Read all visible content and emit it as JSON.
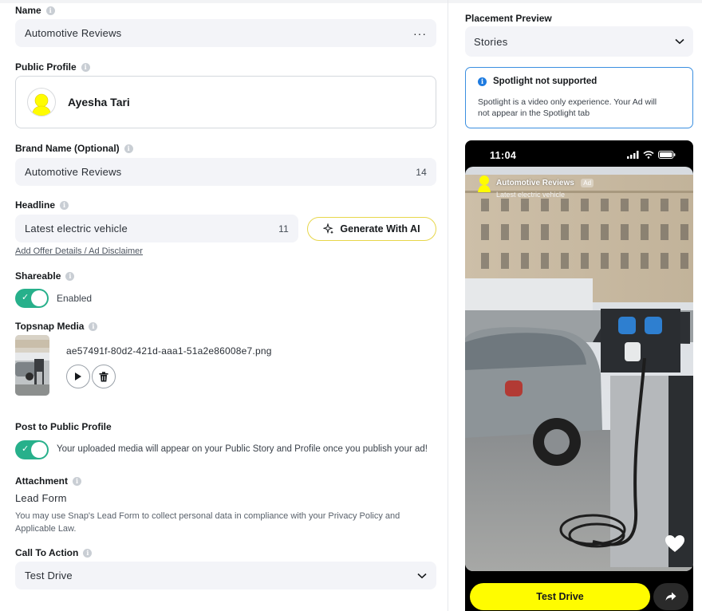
{
  "form": {
    "name": {
      "label": "Name",
      "value": "Automotive Reviews",
      "menu_icon": "more-horizontal-icon"
    },
    "public_profile": {
      "label": "Public Profile",
      "display_name": "Ayesha Tari"
    },
    "brand_name": {
      "label": "Brand Name (Optional)",
      "value": "Automotive Reviews",
      "count": "14"
    },
    "headline": {
      "label": "Headline",
      "value": "Latest electric vehicle",
      "count": "11",
      "generate_label": "Generate With AI",
      "offer_link": "Add Offer Details / Ad Disclaimer"
    },
    "shareable": {
      "label": "Shareable",
      "state": "Enabled",
      "enabled": true
    },
    "topsnap": {
      "label": "Topsnap Media",
      "filename": "ae57491f-80d2-421d-aaa1-51a2e86008e7.png"
    },
    "post_public": {
      "label": "Post to Public Profile",
      "text": "Your uploaded media will appear on your Public Story and Profile once you publish your ad!",
      "enabled": true
    },
    "attachment": {
      "label": "Attachment",
      "value": "Lead Form",
      "note_line1": "You may use Snap's Lead Form to collect personal data in compliance with your Privacy Policy and",
      "note_line2": "Applicable Law."
    },
    "cta": {
      "label": "Call To Action",
      "value": "Test Drive"
    }
  },
  "preview": {
    "label": "Placement Preview",
    "placement": "Stories",
    "notice_title": "Spotlight not supported",
    "notice_line1": "Spotlight is a video only experience. Your Ad will",
    "notice_line2": "not appear in the Spotlight tab",
    "phone_time": "11:04",
    "ad_name": "Automotive Reviews",
    "ad_badge": "Ad",
    "ad_headline": "Latest electric vehicle",
    "cta_label": "Test Drive"
  },
  "colors": {
    "toggle_on": "#27b08b",
    "cta_yellow": "#fffc00",
    "info_blue": "#3b8fe0",
    "ai_border": "#e7d64a"
  }
}
